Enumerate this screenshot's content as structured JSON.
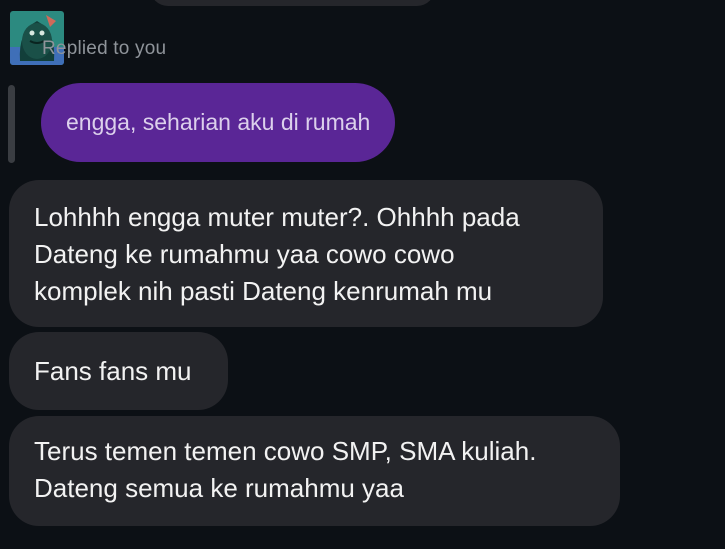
{
  "reply": {
    "label": "Replied to you",
    "avatar_icon": "sticker-avatar",
    "quoted_message": "engga, seharian aku di rumah",
    "quoted_color": "#5a2696"
  },
  "messages": [
    {
      "text": "Lohhhh engga muter muter?. Ohhhh pada\nDateng ke rumahmu yaa cowo cowo\nkomplek nih pasti Dateng kenrumah mu"
    },
    {
      "text": "Fans fans mu"
    },
    {
      "text": "Terus temen temen cowo SMP, SMA kuliah.\nDateng semua ke rumahmu yaa"
    }
  ],
  "colors": {
    "background": "#0c1015",
    "incoming_bubble": "#25262b",
    "reply_label": "#8f949a"
  }
}
